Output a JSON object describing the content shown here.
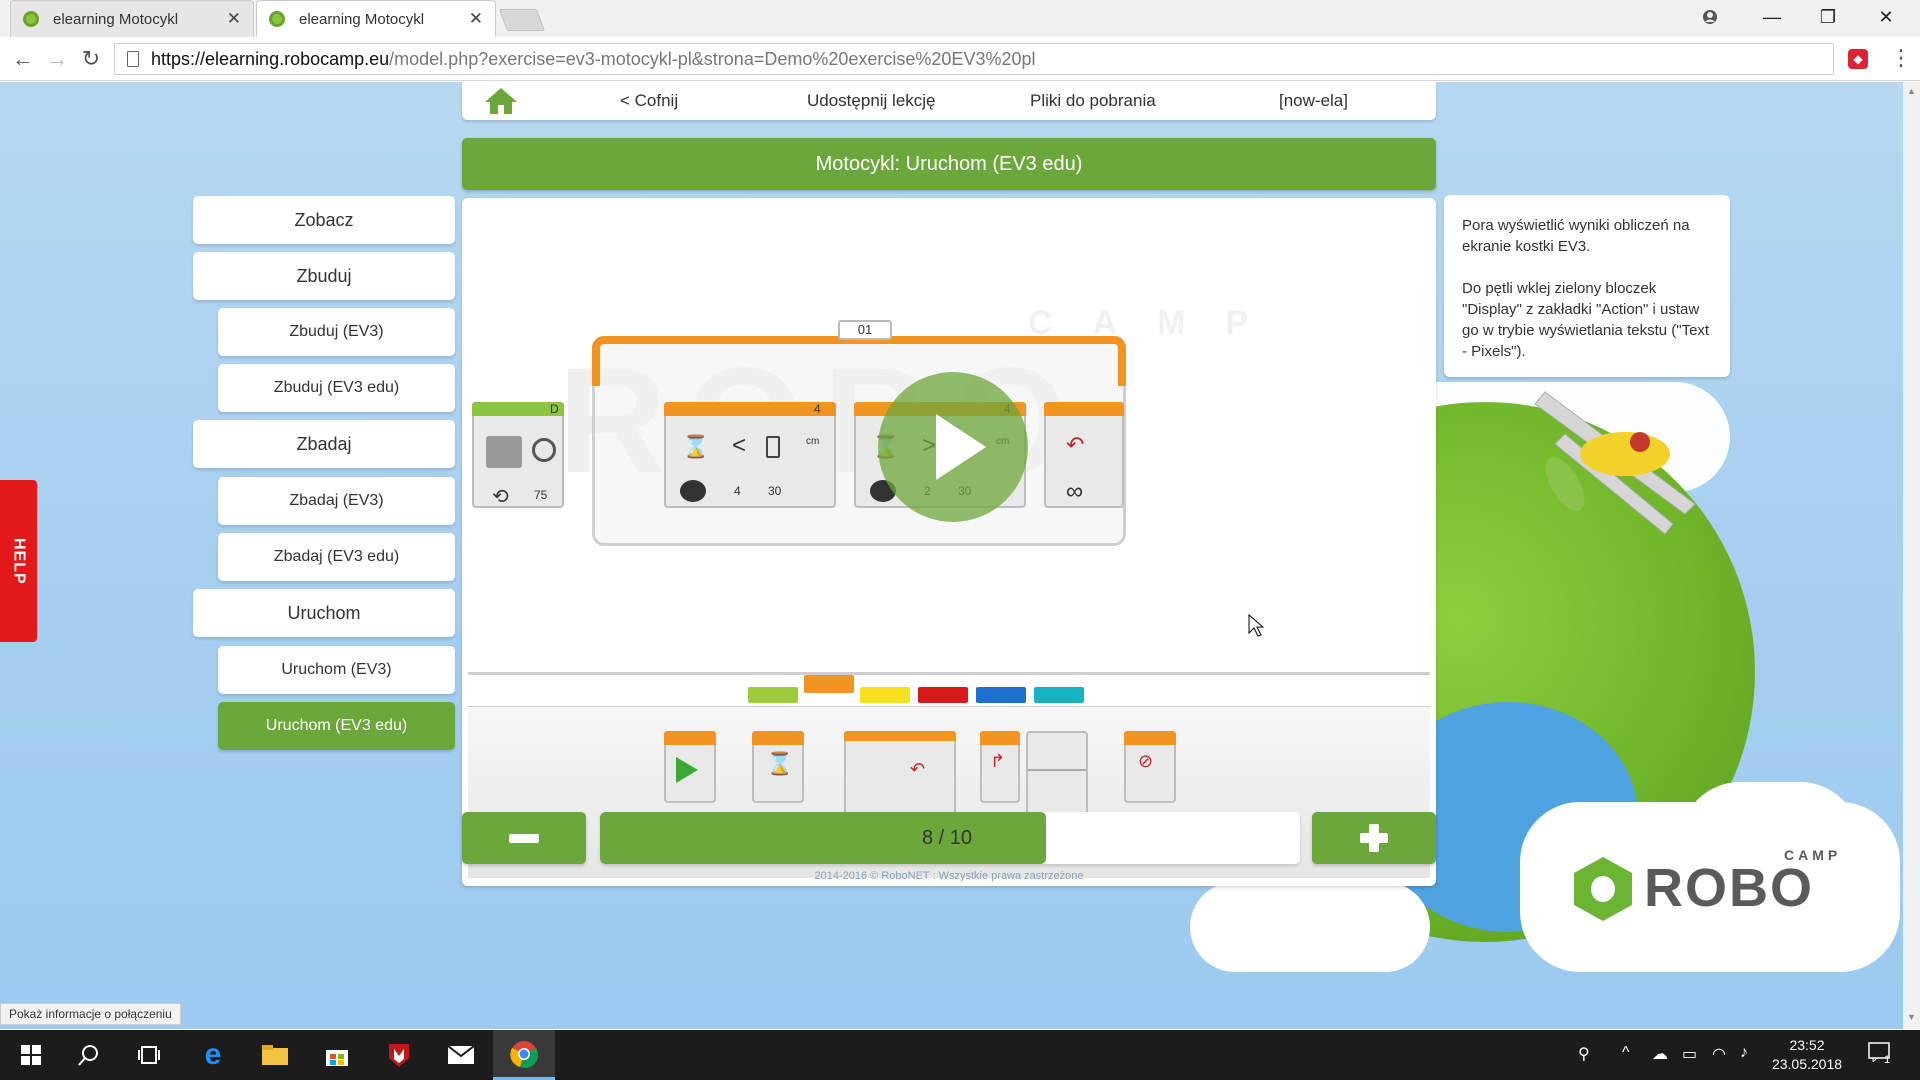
{
  "browser": {
    "tabs": [
      {
        "title": "elearning Motocykl",
        "close": "✕"
      },
      {
        "title": "elearning Motocykl",
        "close": "✕"
      }
    ],
    "window_controls": {
      "minimize": "—",
      "restore": "❐",
      "close": "✕"
    },
    "url_host": "https://elearning.robocamp.eu",
    "url_path": "/model.php?exercise=ev3-motocykl-pl&strona=Demo%20exercise%20EV3%20pl",
    "back_icon": "←",
    "forward_icon": "→",
    "reload_icon": "↻",
    "menu_icon": "⋮"
  },
  "topnav": {
    "back": "< Cofnij",
    "share": "Udostępnij lekcję",
    "downloads": "Pliki do pobrania",
    "user": "[now-ela]"
  },
  "title": "Motocykl: Uruchom (EV3 edu)",
  "menu": [
    {
      "label": "Zobacz",
      "level": 1
    },
    {
      "label": "Zbuduj",
      "level": 1
    },
    {
      "label": "Zbuduj (EV3)",
      "level": 2
    },
    {
      "label": "Zbuduj (EV3 edu)",
      "level": 2
    },
    {
      "label": "Zbadaj",
      "level": 1
    },
    {
      "label": "Zbadaj (EV3)",
      "level": 2
    },
    {
      "label": "Zbadaj (EV3 edu)",
      "level": 2
    },
    {
      "label": "Uruchom",
      "level": 1
    },
    {
      "label": "Uruchom (EV3)",
      "level": 2
    },
    {
      "label": "Uruchom (EV3 edu)",
      "level": 2,
      "selected": true
    }
  ],
  "help": "HELP",
  "program": {
    "loop_label": "01",
    "start_value": "75",
    "blocks": [
      {
        "port": "4",
        "compare": "<",
        "value1": "4",
        "value2": "30"
      },
      {
        "port": "4",
        "compare": ">",
        "value1": "2",
        "value2": "30"
      }
    ],
    "start_port": "D",
    "watermark": "ROBO",
    "watermark_camp": "CAMP"
  },
  "palette_colors": [
    "#9ccc3c",
    "#f39321",
    "#f6e020",
    "#d7191c",
    "#1f6fcf",
    "#17b3c4"
  ],
  "instructions": {
    "p1": "Pora wyświetlić wyniki obliczeń na ekranie kostki EV3.",
    "p2": "Do pętli wklej zielony bloczek \"Display\" z zakładki \"Action\" i ustaw go w trybie wyświetlania tekstu (\"Text - Pixels\")."
  },
  "progress": {
    "label": "8 / 10",
    "current": 8,
    "total": 10,
    "fill_fraction": 0.637
  },
  "copyright": "2014-2016 © RoboNET : Wszystkie prawa zastrzeżone",
  "logo": {
    "camp": "CAMP",
    "robo": "ROBO"
  },
  "status_tooltip": "Pokaż informacje o połączeniu",
  "taskbar": {
    "time": "23:52",
    "date": "23.05.2018",
    "notifications": "1"
  }
}
